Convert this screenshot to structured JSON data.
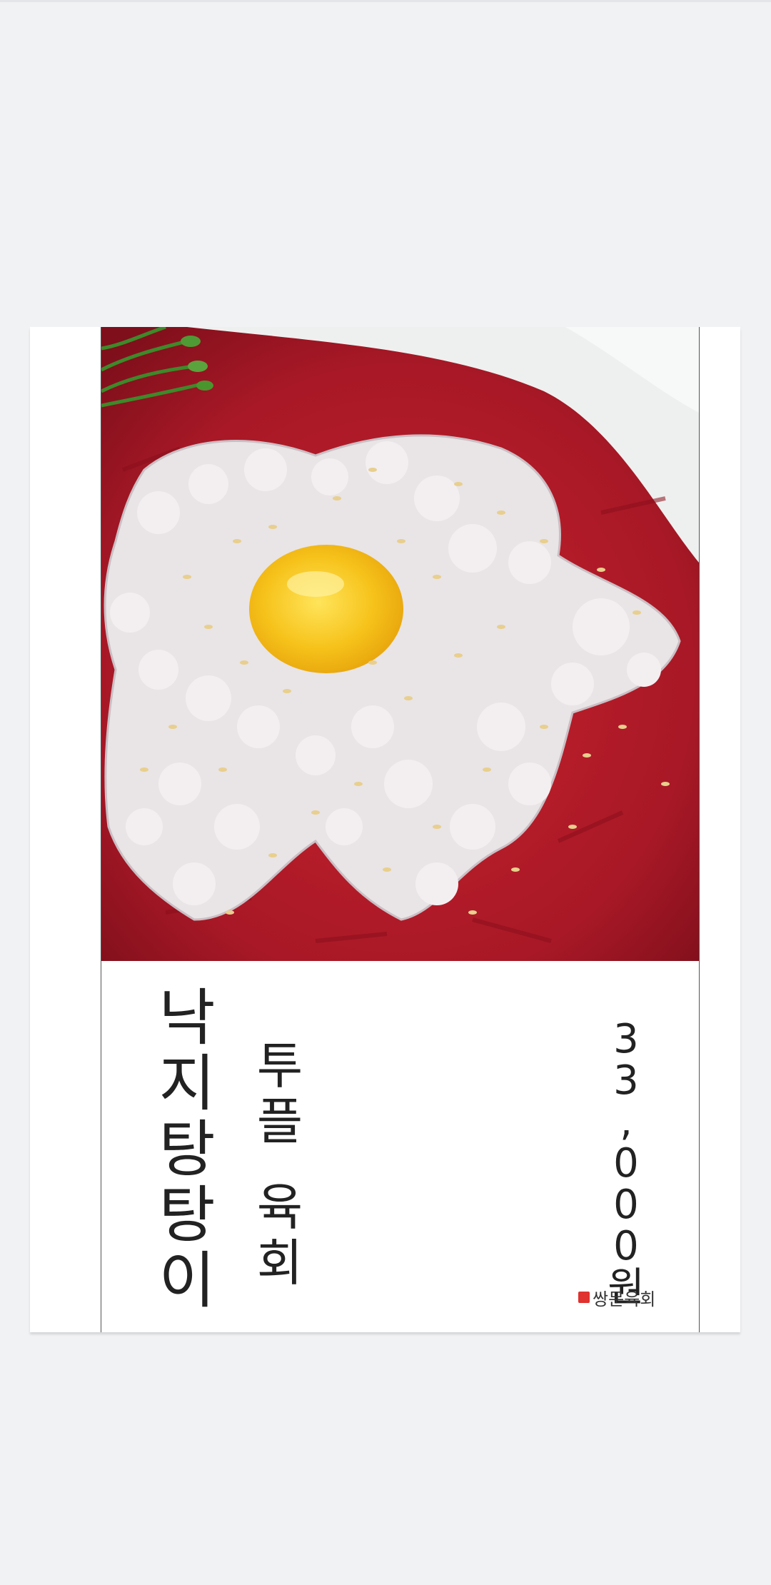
{
  "menu": {
    "name_line1_chars": [
      "낙",
      "지",
      "탕",
      "탕",
      "이"
    ],
    "name_line2_chars": [
      "투",
      "플"
    ],
    "name_line2b_chars": [
      "육",
      "회"
    ],
    "price_chars": [
      "3",
      "3",
      ",",
      "0",
      "0",
      "0",
      "원"
    ],
    "brand": "쌍문육회"
  },
  "colors": {
    "background": "#f1f2f4",
    "card": "#ffffff",
    "seal": "#e0322e",
    "text": "#222222"
  },
  "icons": {
    "brand_seal": "red-seal-stamp-icon"
  }
}
